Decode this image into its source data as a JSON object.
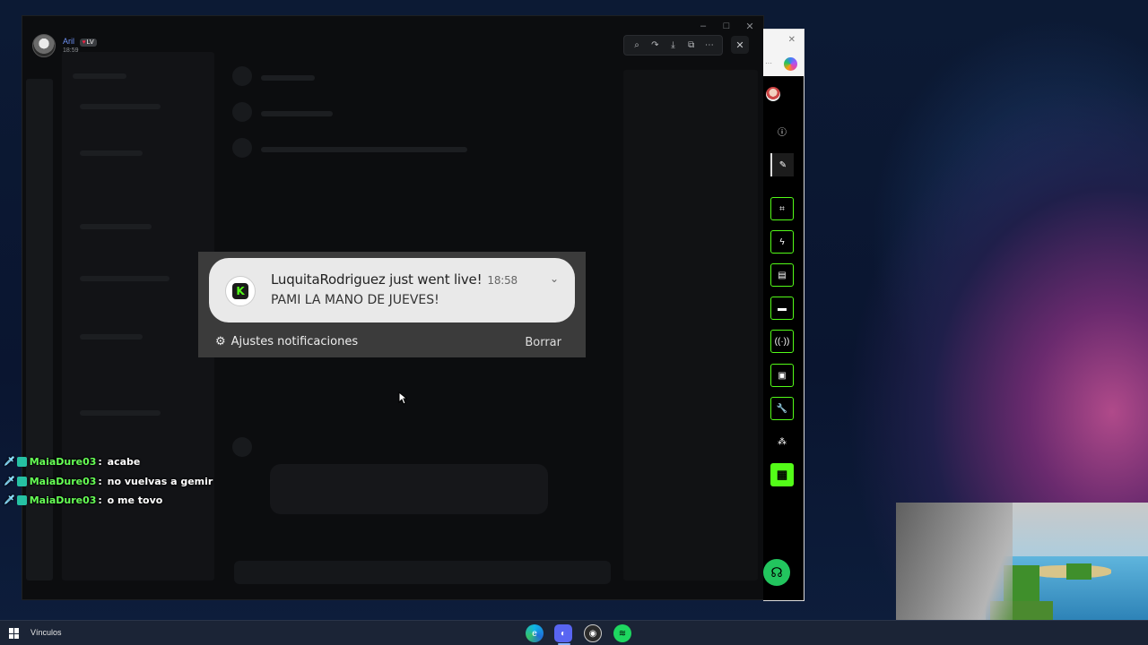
{
  "viewer": {
    "user_name": "Aril",
    "user_badge": "LV",
    "time": "18:59",
    "toolbar_icons": [
      "zoom-icon",
      "redo-icon",
      "download-icon",
      "open-external-icon",
      "more-icon"
    ],
    "close_label": "✕"
  },
  "window_controls": {
    "minimize": "–",
    "maximize": "□",
    "close": "✕"
  },
  "notification": {
    "title": "LuquitaRodriguez just went live!",
    "time": "18:58",
    "body": "PAMI LA MANO DE JUEVES!",
    "settings_label": "Ajustes notificaciones",
    "clear_label": "Borrar",
    "app_logo_letter": "K",
    "brand_color": "#53fc18"
  },
  "chat": {
    "messages": [
      {
        "user": "MaiaDure03",
        "text": "acabe"
      },
      {
        "user": "MaiaDure03",
        "text": "no vuelvas a gemir"
      },
      {
        "user": "MaiaDure03",
        "text": "o me tovo"
      }
    ]
  },
  "side_panel": {
    "close_label": "✕",
    "menu_label": "···",
    "buttons": [
      "info-icon",
      "pencil-icon",
      "screenshot-icon",
      "bolt-icon",
      "notes-icon",
      "chat-icon",
      "broadcast-icon",
      "layout-icon",
      "wrench-icon",
      "share-icon",
      "clapper-icon"
    ],
    "accent_color": "#53fc18"
  },
  "taskbar": {
    "label": "Vínculos",
    "apps": [
      "edge-icon",
      "discord-icon",
      "obs-icon",
      "spotify-icon"
    ]
  }
}
